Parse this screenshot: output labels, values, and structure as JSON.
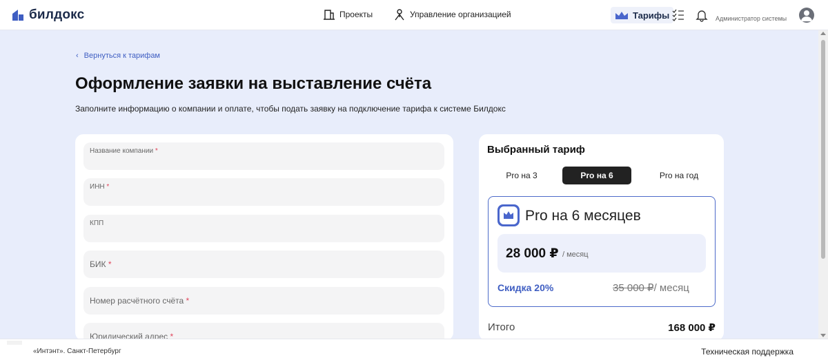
{
  "header": {
    "logo_text": "билдокс",
    "nav": {
      "projects": "Проекты",
      "org_management": "Управление организацией"
    },
    "tariffs": "Тарифы",
    "user_name": "Администратор системы"
  },
  "main": {
    "back_link": "Вернуться к тарифам",
    "title": "Оформление заявки на выставление счёта",
    "subtitle": "Заполните информацию о компании и оплате, чтобы подать заявку на подключение тарифа к системе Билдокс"
  },
  "form": {
    "fields": [
      {
        "label": "Название компании",
        "required": "*",
        "value": ""
      },
      {
        "label": "ИНН",
        "required": "*",
        "value": ""
      },
      {
        "label": "КПП",
        "required": "",
        "value": ""
      },
      {
        "label": "БИК",
        "required": "*",
        "value": ""
      },
      {
        "label": "Номер расчётного счёта",
        "required": "*",
        "value": ""
      },
      {
        "label": "Юридический адрес",
        "required": "*",
        "value": ""
      }
    ]
  },
  "tariff": {
    "title": "Выбранный тариф",
    "tabs": [
      "Pro на 3",
      "Pro на 6",
      "Pro на год"
    ],
    "selected_tab": "Pro на 6",
    "plan_name": "Pro на 6 месяцев",
    "price": "28 000 ₽",
    "price_unit": "/ месяц",
    "discount": "Скидка 20%",
    "old_price": "35 000 ₽",
    "old_price_unit": "/ месяц",
    "total_label": "Итого",
    "total_value": "168 000 ₽"
  },
  "footer": {
    "org": "«Интэнт». Санкт-Петербург",
    "support": "Техническая поддержка"
  },
  "colors": {
    "accent": "#3f5ec2",
    "page_bg": "#e8edfb",
    "selected_tab": "#222222",
    "required": "#e0445a"
  }
}
